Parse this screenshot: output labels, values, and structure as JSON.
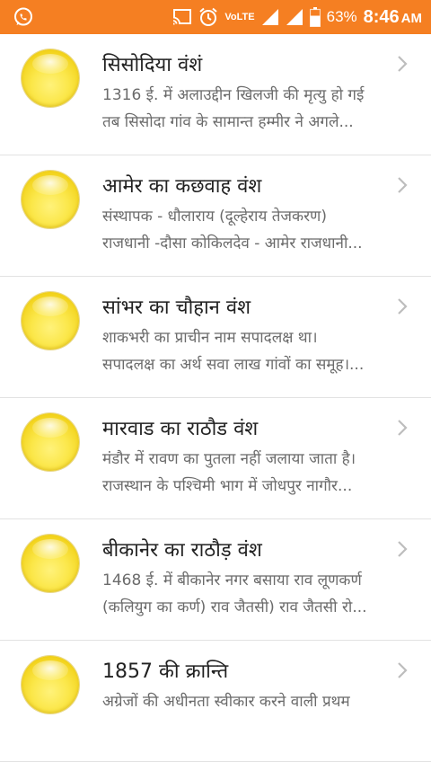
{
  "status_bar": {
    "volte": "VoLTE",
    "battery": "63%",
    "time": "8:46",
    "ampm": "AM",
    "icons": [
      "whatsapp-icon",
      "cast-icon",
      "alarm-icon",
      "signal-icon",
      "signal-icon",
      "battery-icon"
    ],
    "bg_color": "#f57f22"
  },
  "items": [
    {
      "title": "सिसोदिया वंशं",
      "line1": "1316 ई. में अलाउद्दीन खिलजी की मृत्यु हो गई",
      "line2": "तब सिसोदा गांव के सामान्त हम्मीर ने अगले..."
    },
    {
      "title": "आमेर का कछवाह वंश",
      "line1": "संस्थापक - धौलाराय (दूल्हेराय तेजकरण)",
      "line2": "राजधानी -दौसा कोकिलदेव - आमेर राजधानी..."
    },
    {
      "title": "सांभर का चौहान वंश",
      "line1": "शाकभरी का प्राचीन नाम सपादलक्ष था।",
      "line2": "सपादलक्ष का अर्थ सवा लाख गांवों का समूह।..."
    },
    {
      "title": "मारवाड का राठौड वंश",
      "line1": "मंडौर में रावण का पुतला नहीं जलाया जाता है।",
      "line2": "राजस्थान के पश्चिमी भाग में जोधपुर नागौर..."
    },
    {
      "title": "बीकानेर का राठौड़ वंश",
      "line1": "1468 ई. में बीकानेर नगर बसाया राव लूणकर्ण",
      "line2": "(कलियुग का कर्ण) राव जैतसी) राव जैतसी रो..."
    },
    {
      "title": "1857 की क्रान्ति",
      "line1": "अग्रेजों की अधीनता स्वीकार करने वाली प्रथम",
      "line2": ""
    }
  ]
}
